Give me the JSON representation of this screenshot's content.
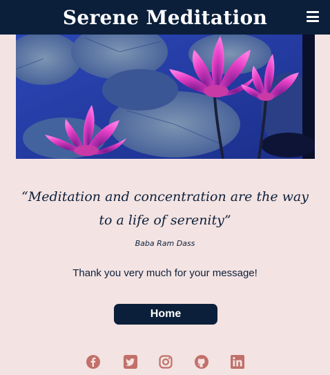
{
  "header": {
    "brand": "Serene Meditation",
    "menu_icon": "hamburger-menu-icon"
  },
  "hero": {
    "image": "pink-water-lilies-on-lily-pads"
  },
  "quote": {
    "text": "“Meditation and concentration are the way to a life of serenity”",
    "author": "Baba Ram Dass"
  },
  "message": "Thank you very much for your message!",
  "home_button": "Home",
  "socials": [
    {
      "name": "facebook-icon"
    },
    {
      "name": "twitter-icon"
    },
    {
      "name": "instagram-icon"
    },
    {
      "name": "github-icon"
    },
    {
      "name": "linkedin-icon"
    }
  ],
  "colors": {
    "navy": "#0b1f3a",
    "background": "#f3e3e2",
    "social_icon": "#c1706a"
  }
}
